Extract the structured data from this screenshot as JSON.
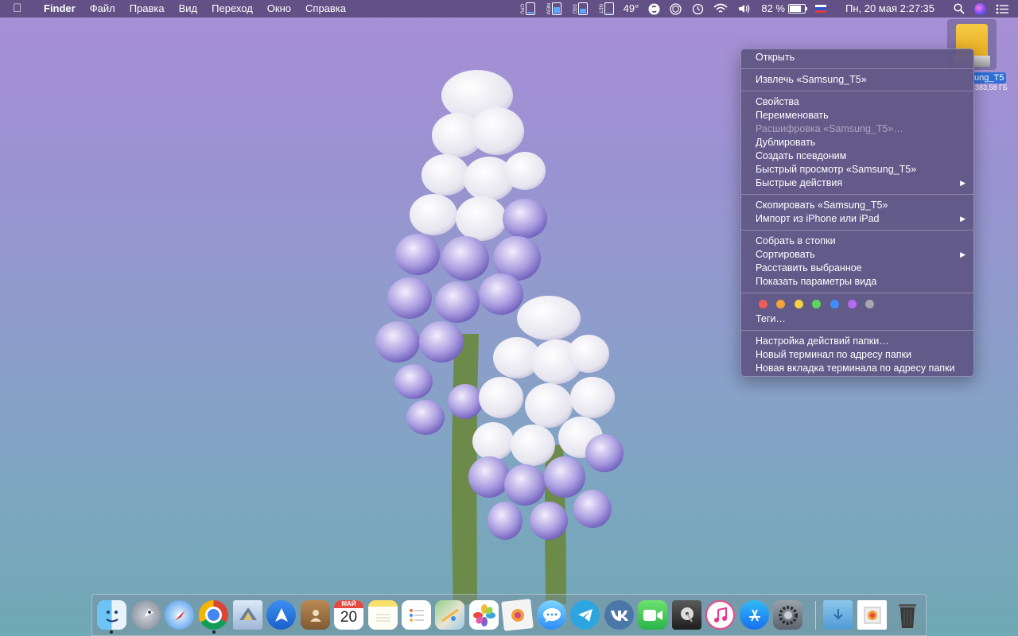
{
  "menubar": {
    "app_name": "Finder",
    "items": [
      "Файл",
      "Правка",
      "Вид",
      "Переход",
      "Окно",
      "Справка"
    ],
    "temperature": "49°",
    "battery_percent": "82 %",
    "datetime": "Пн, 20 мая  2:27:35",
    "meters": [
      "CPU",
      "MEM",
      "SSD",
      "NET"
    ]
  },
  "drive": {
    "label": "ung_T5",
    "size": "383,58 ГБ"
  },
  "context_menu": {
    "groups": [
      [
        "Открыть"
      ],
      [
        "Извлечь «Samsung_T5»"
      ],
      [
        "Свойства",
        "Переименовать",
        "Расшифровка «Samsung_T5»…",
        "Дублировать",
        "Создать псевдоним",
        "Быстрый просмотр «Samsung_T5»",
        "Быстрые действия"
      ],
      [
        "Скопировать «Samsung_T5»",
        "Импорт из iPhone или iPad"
      ],
      [
        "Собрать в стопки",
        "Сортировать",
        "Расставить выбранное",
        "Показать параметры вида"
      ],
      [
        "Теги…"
      ],
      [
        "Настройка действий папки…",
        "Новый терминал по адресу папки",
        "Новая вкладка терминала по адресу папки"
      ]
    ],
    "tag_colors": [
      "#ee5b5b",
      "#f3a33a",
      "#f5d23e",
      "#5fd35f",
      "#3f8ef7",
      "#b66af0",
      "#a7a7a7"
    ]
  },
  "dock": {
    "calendar_month": "МАЙ",
    "calendar_day": "20"
  }
}
